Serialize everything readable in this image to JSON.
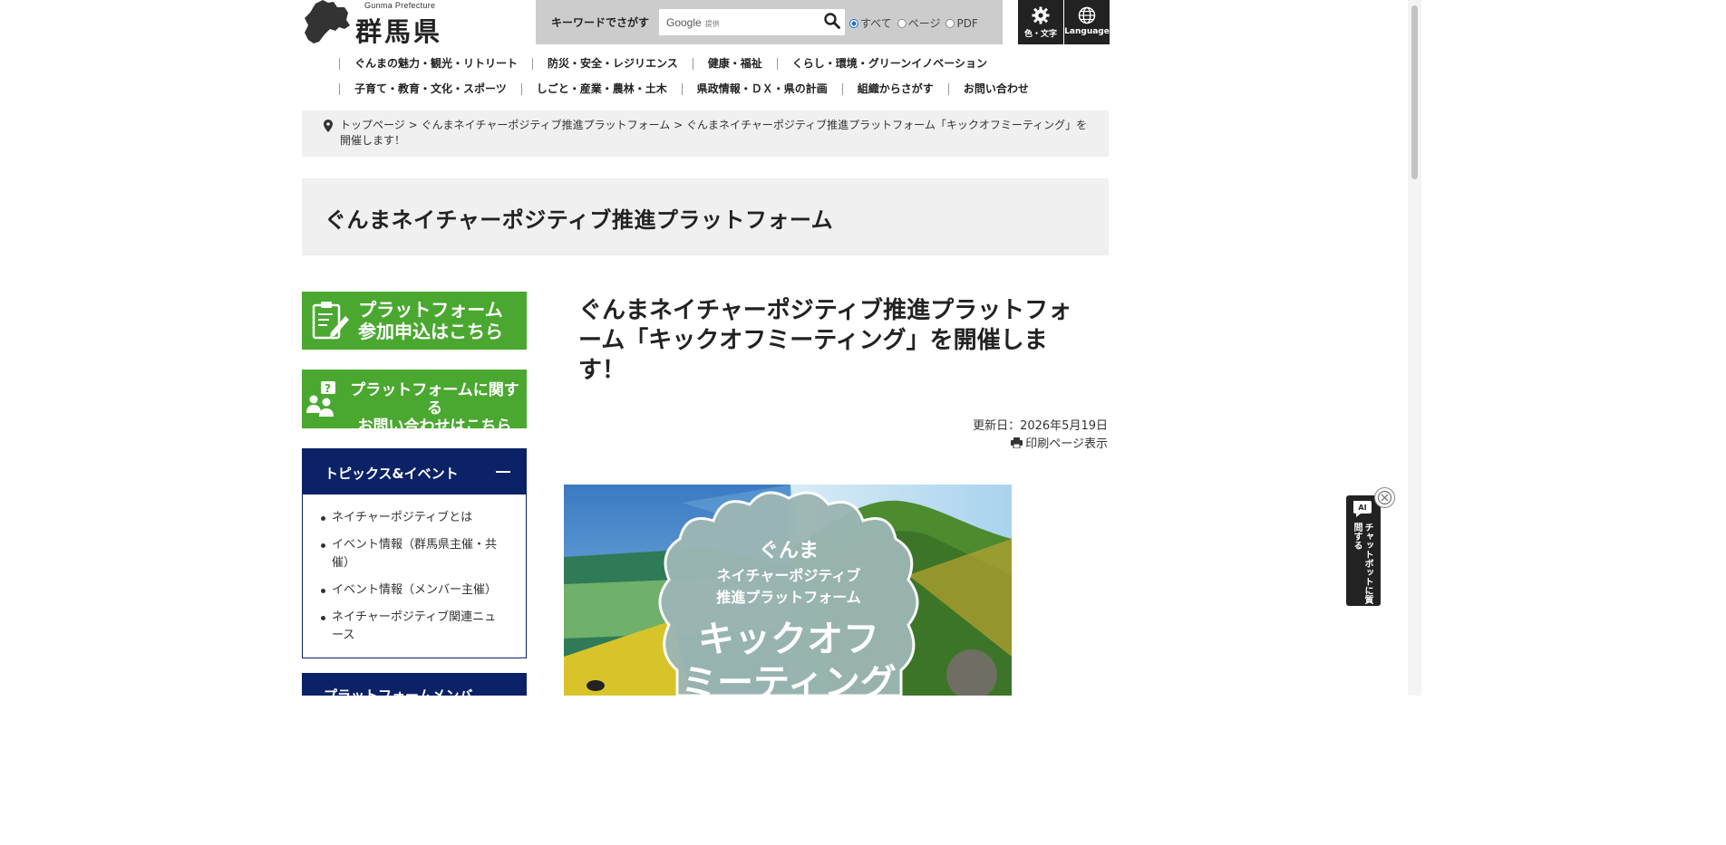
{
  "header": {
    "pref_en": "Gunma Prefecture",
    "pref_jp": "群馬県",
    "search_label": "キーワードでさがす",
    "search_google": "Google",
    "search_google_sub": "提供",
    "radios": [
      {
        "label": "すべて",
        "checked": true
      },
      {
        "label": "ページ",
        "checked": false
      },
      {
        "label": "PDF",
        "checked": false
      }
    ],
    "tool_color": "色・文字",
    "tool_language": "Language"
  },
  "nav": {
    "row1": [
      "ぐんまの魅力・観光・リトリート",
      "防災・安全・レジリエンス",
      "健康・福祉",
      "くらし・環境・グリーンイノベーション"
    ],
    "row2": [
      "子育て・教育・文化・スポーツ",
      "しごと・産業・農林・土木",
      "県政情報・ＤＸ・県の計画",
      "組織からさがす",
      "お問い合わせ"
    ]
  },
  "breadcrumb": {
    "items": [
      "トップページ",
      "ぐんまネイチャーポジティブ推進プラットフォーム",
      "ぐんまネイチャーポジティブ推進プラットフォーム「キックオフミーティング」を開催します！"
    ],
    "sep": ">"
  },
  "category_title": "ぐんまネイチャーポジティブ推進プラットフォーム",
  "sidebar": {
    "apply_line1": "プラットフォーム",
    "apply_line2": "参加申込はこちら",
    "contact_line1": "プラットフォームに関する",
    "contact_line2": "お問い合わせはこちら",
    "topics_title": "トピックス&イベント",
    "topics_items": [
      "ネイチャーポジティブとは",
      "イベント情報（群馬県主催・共催）",
      "イベント情報（メンバー主催）",
      "ネイチャーポジティブ関連ニュース"
    ],
    "members_title": "プラットフォームメンバ"
  },
  "article": {
    "title": "ぐんまネイチャーポジティブ推進プラットフォーム「キックオフミーティング」を開催します！",
    "updated": "更新日：2026年5月19日",
    "print": "印刷ページ表示"
  },
  "hero": {
    "line1": "ぐんま",
    "line2": "ネイチャーポジティブ",
    "line3": "推進プラットフォーム",
    "line4": "キックオフ",
    "line5": "ミーティング"
  },
  "chatbot": {
    "label": "チャットボットに質問する",
    "badge": "AI"
  },
  "colors": {
    "green": "#4aa830",
    "navy": "#0b2266",
    "gray_bg": "#f0f0f0"
  }
}
